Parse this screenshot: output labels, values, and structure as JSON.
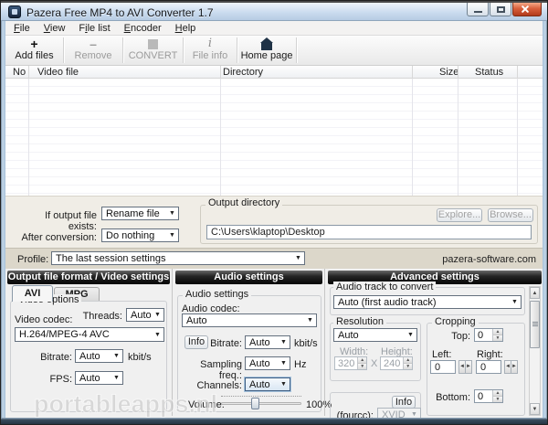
{
  "window": {
    "title": "Pazera Free MP4 to AVI Converter 1.7"
  },
  "menu": {
    "items": [
      {
        "pre": "",
        "key": "F",
        "rest": "ile"
      },
      {
        "pre": "",
        "key": "V",
        "rest": "iew"
      },
      {
        "pre": "F",
        "key": "i",
        "rest": "le list"
      },
      {
        "pre": "",
        "key": "E",
        "rest": "ncoder"
      },
      {
        "pre": "",
        "key": "H",
        "rest": "elp"
      }
    ]
  },
  "toolbar": {
    "buttons": [
      {
        "label": "Add files",
        "icon": "plus-icon",
        "glyph": "+",
        "enabled": true
      },
      {
        "label": "Remove",
        "icon": "minus-icon",
        "glyph": "–",
        "enabled": false
      },
      {
        "label": "CONVERT",
        "icon": "stop-square-icon",
        "glyph": "",
        "enabled": false
      },
      {
        "label": "File info",
        "icon": "info-italic-icon",
        "glyph": "i",
        "enabled": false
      },
      {
        "label": "Home page",
        "icon": "home-icon",
        "glyph": "",
        "enabled": true
      }
    ]
  },
  "file_list": {
    "columns": [
      "No",
      "Video file",
      "Directory",
      "Size",
      "Status"
    ]
  },
  "options": {
    "if_exists_label": "If output file exists:",
    "if_exists_value": "Rename file",
    "after_label": "After conversion:",
    "after_value": "Do nothing",
    "output_dir_label": "Output directory",
    "output_dir_path": "C:\\Users\\klaptop\\Desktop",
    "explore_label": "Explore...",
    "browse_label": "Browse..."
  },
  "profile": {
    "label": "Profile:",
    "value": "The last session settings",
    "website": "pazera-software.com"
  },
  "video_panel": {
    "header": "Output file format / Video settings",
    "tab_avi": "AVI",
    "tab_mpg": "MPG",
    "group": "Video options",
    "video_codec_label": "Video codec:",
    "threads_label": "Threads:",
    "threads_value": "Auto",
    "codec_value": "H.264/MPEG-4 AVC",
    "bitrate_label": "Bitrate:",
    "bitrate_value": "Auto",
    "bitrate_unit": "kbit/s",
    "fps_label": "FPS:",
    "fps_value": "Auto"
  },
  "audio_panel": {
    "header": "Audio settings",
    "group": "Audio settings",
    "codec_label": "Audio codec:",
    "codec_value": "Auto",
    "info_label": "Info",
    "bitrate_label": "Bitrate:",
    "bitrate_value": "Auto",
    "bitrate_unit": "kbit/s",
    "sampling_label": "Sampling freq.:",
    "sampling_value": "Auto",
    "sampling_unit": "Hz",
    "channels_label": "Channels:",
    "channels_value": "Auto",
    "volume_label": "Volume:",
    "volume_value": "100%"
  },
  "advanced_panel": {
    "header": "Advanced settings",
    "audio_track_label": "Audio track to convert",
    "audio_track_value": "Auto (first audio track)",
    "resolution_label": "Resolution",
    "resolution_value": "Auto",
    "width_label": "Width:",
    "width_value": "320",
    "x_label": "X",
    "height_label": "Height:",
    "height_value": "240",
    "cropping_label": "Cropping",
    "top_label": "Top:",
    "top_value": "0",
    "left_label": "Left:",
    "left_value": "0",
    "right_label": "Right:",
    "right_value": "0",
    "bottom_label": "Bottom:",
    "bottom_value": "0",
    "info_label": "Info",
    "fourcc_label": "(fourcc):",
    "fourcc_value": "XVID"
  },
  "watermark": "portableapps.nl",
  "colors": {
    "close_button": "#c14a2b",
    "panel_header": "#1d1d1d",
    "titlebar": "#c7d8ec",
    "options_bg": "#f0ede6",
    "profile_bg": "#dcd7ca"
  }
}
